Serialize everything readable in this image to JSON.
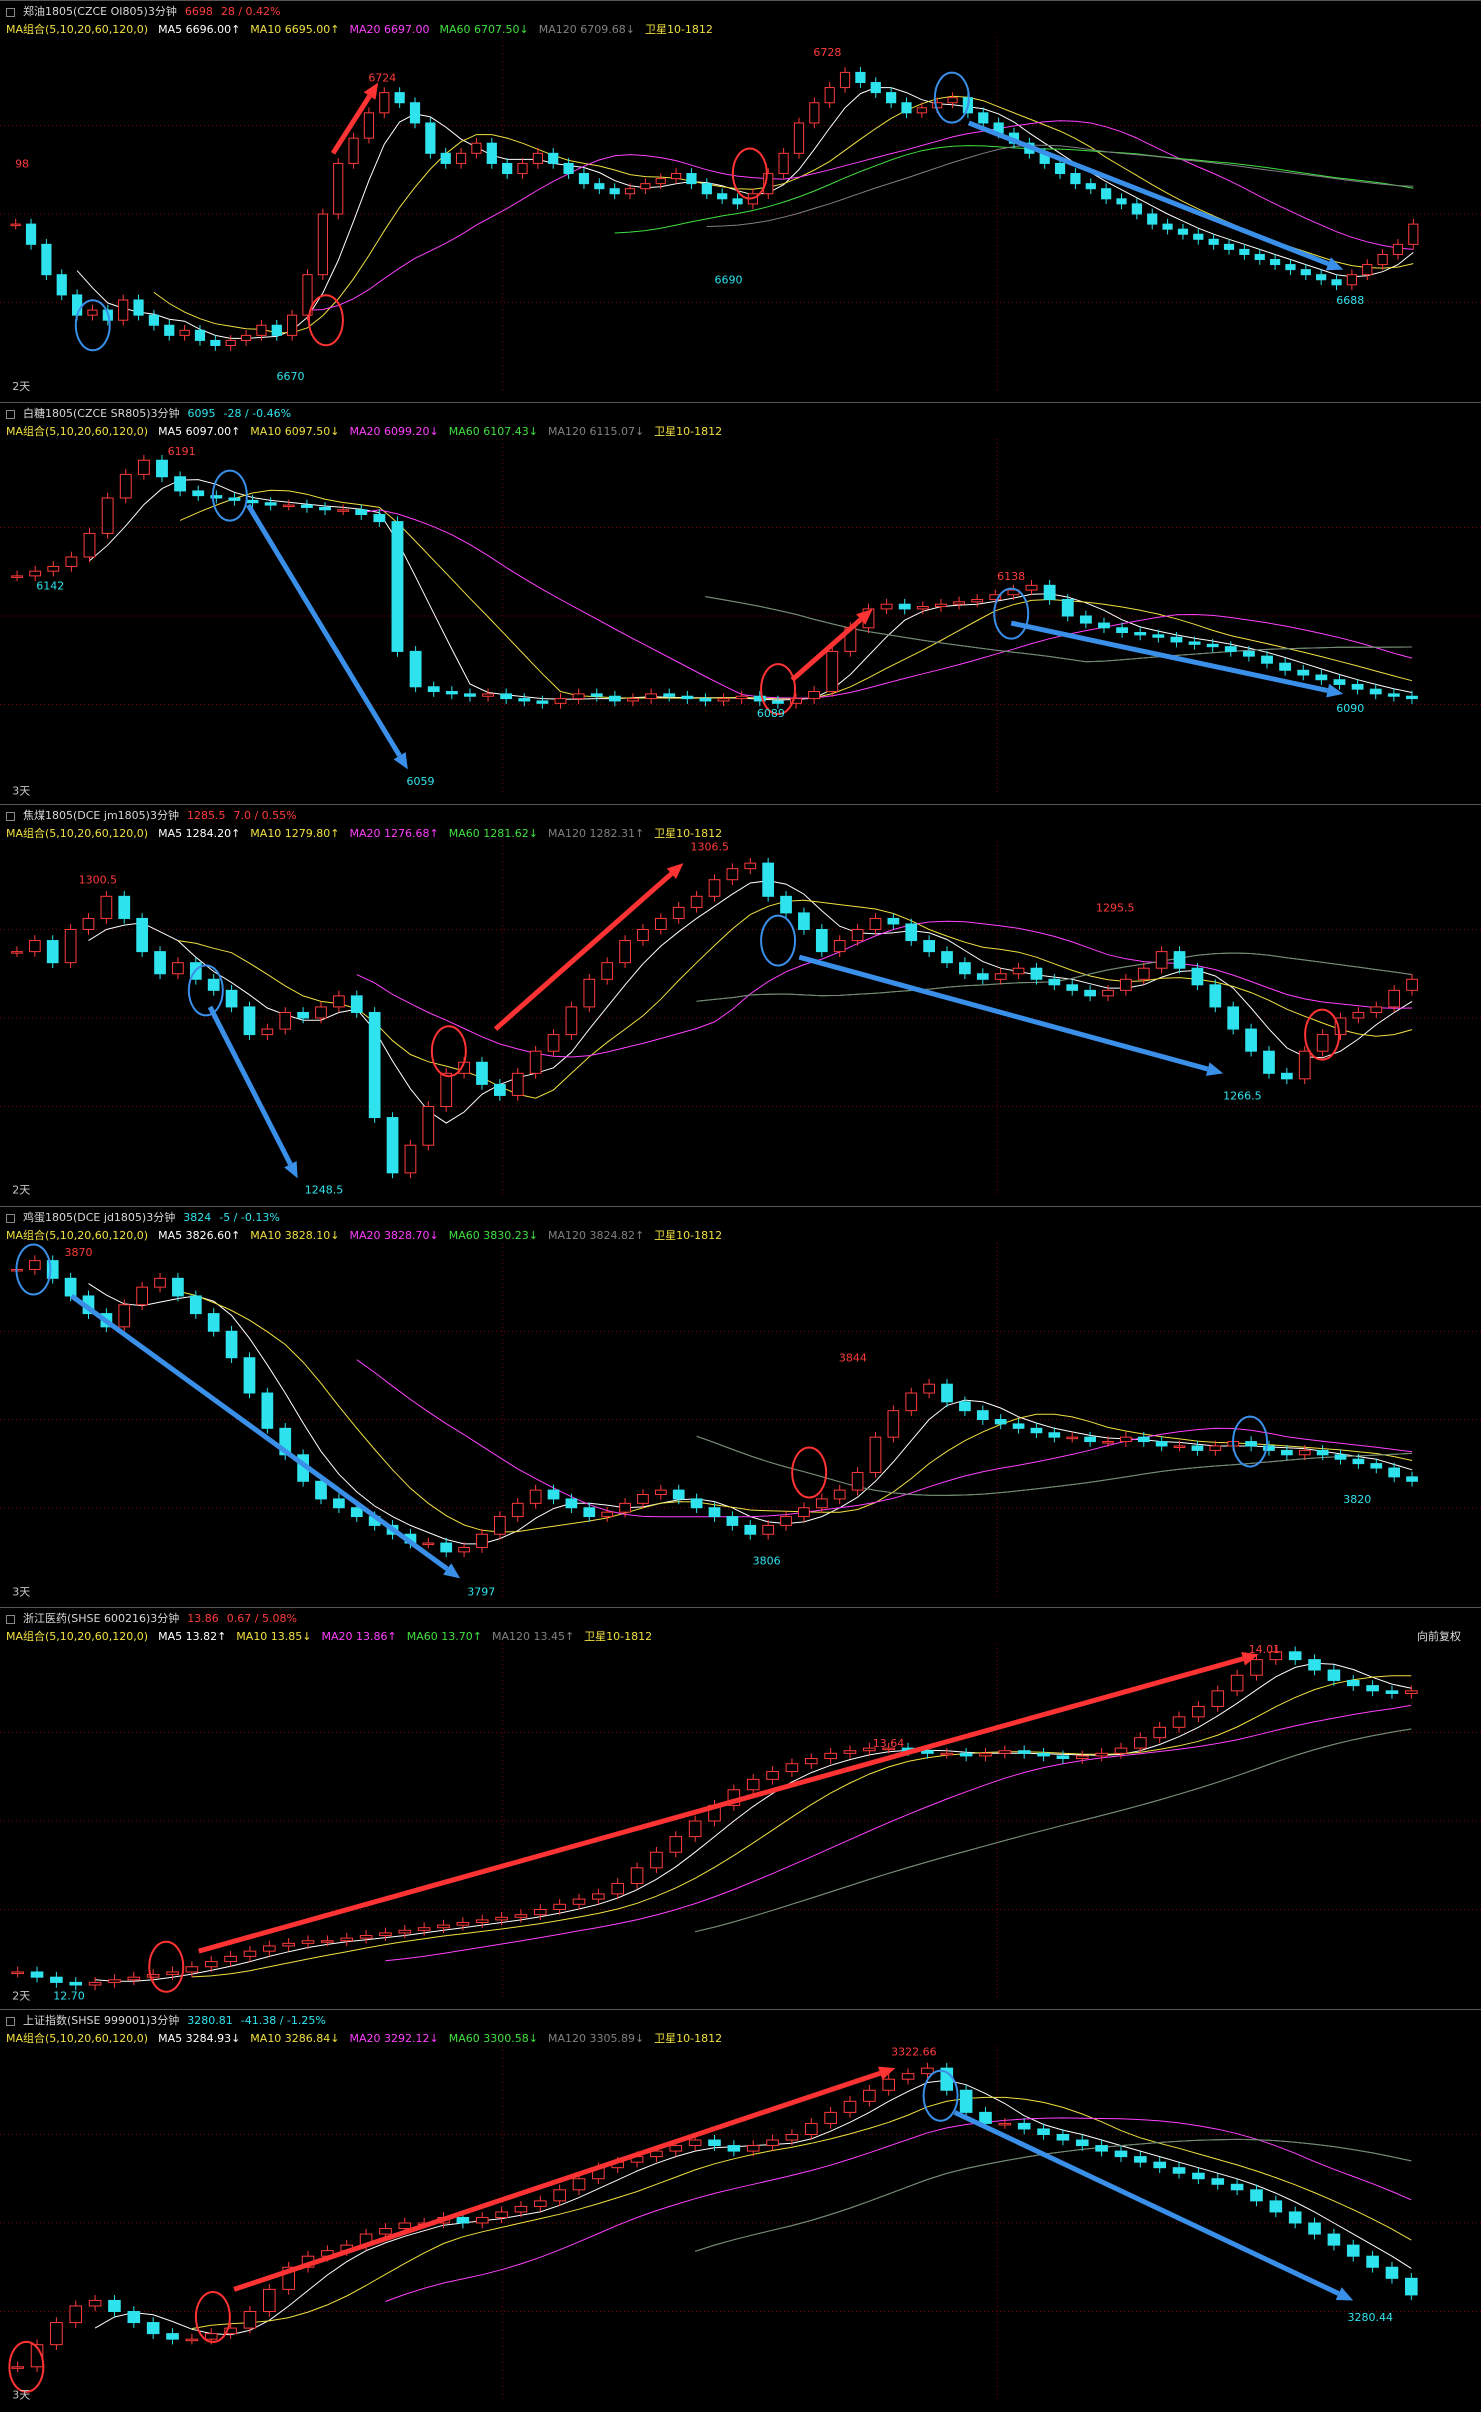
{
  "ma_settings": "MA组合(5,10,20,60,120,0)",
  "colors": {
    "up": "#ff3b3b",
    "down": "#2fe3ee",
    "ma5": "#ffffff",
    "ma10": "#f0e040",
    "ma20": "#ff40ff",
    "ma60": "#40e040",
    "ma120": "#808080",
    "grid": "#7a0000",
    "arrow_red": "#ff3333",
    "arrow_blue": "#3a8fe8",
    "circle_red": "#ff3333",
    "circle_blue": "#3a8fe8"
  },
  "panels": [
    {
      "name": "zhengyou",
      "title": "郑油1805(CZCE OI805)3分钟",
      "price": "6698",
      "change": "28 / 0.42%",
      "ma": {
        "ma5": "MA5 6696.00↑",
        "ma10": "MA10 6695.00↑",
        "ma20": "MA20 6697.00",
        "ma60": "MA60 6707.50↓",
        "ma120": "MA120 6709.68↓",
        "period": "卫星10-1812"
      },
      "range": [
        6665,
        6735
      ],
      "closes": [
        6698,
        6694,
        6688,
        6684,
        6680,
        6681,
        6679,
        6683,
        6680,
        6678,
        6676,
        6677,
        6675,
        6674,
        6675,
        6676,
        6678,
        6676,
        6680,
        6688,
        6700,
        6710,
        6715,
        6720,
        6724,
        6722,
        6718,
        6712,
        6710,
        6712,
        6714,
        6710,
        6708,
        6710,
        6712,
        6710,
        6708,
        6706,
        6705,
        6704,
        6705,
        6706,
        6707,
        6708,
        6706,
        6704,
        6703,
        6702,
        6704,
        6708,
        6712,
        6718,
        6722,
        6725,
        6728,
        6726,
        6724,
        6722,
        6720,
        6721,
        6722,
        6723,
        6720,
        6718,
        6716,
        6714,
        6712,
        6710,
        6708,
        6706,
        6705,
        6703,
        6702,
        6700,
        6698,
        6697,
        6696,
        6695,
        6694,
        6693,
        6692,
        6691,
        6690,
        6689,
        6688,
        6687,
        6686,
        6688,
        6690,
        6692,
        6694,
        6698
      ],
      "labels": [
        {
          "t": "98",
          "x": 0.005,
          "v": 6710,
          "c": "up"
        },
        {
          "t": "6724",
          "x": 0.255,
          "v": 6727,
          "c": "up"
        },
        {
          "t": "6728",
          "x": 0.57,
          "v": 6732,
          "c": "up"
        },
        {
          "t": "6690",
          "x": 0.5,
          "v": 6687,
          "c": "down"
        },
        {
          "t": "6670",
          "x": 0.19,
          "v": 6668,
          "c": "down"
        },
        {
          "t": "6688",
          "x": 0.94,
          "v": 6683,
          "c": "down"
        },
        {
          "t": "2天",
          "x": 0.003,
          "v": 6666,
          "c": "neutral"
        }
      ],
      "arrows": [
        {
          "x1": 0.23,
          "v1": 6712,
          "x2": 0.262,
          "v2": 6726,
          "c": "red"
        },
        {
          "x1": 0.68,
          "v1": 6718,
          "x2": 0.945,
          "v2": 6689,
          "c": "blue"
        }
      ],
      "circles": [
        {
          "x": 0.06,
          "v": 6678,
          "c": "blue"
        },
        {
          "x": 0.225,
          "v": 6679,
          "c": "red"
        },
        {
          "x": 0.525,
          "v": 6708,
          "c": "red"
        },
        {
          "x": 0.668,
          "v": 6723,
          "c": "blue"
        }
      ]
    },
    {
      "name": "baitang",
      "title": "白糖1805(CZCE SR805)3分钟",
      "price": "6095",
      "change": "-28 / -0.46%",
      "ma": {
        "ma5": "MA5 6097.00↑",
        "ma10": "MA10 6097.50↓",
        "ma20": "MA20 6099.20↓",
        "ma60": "MA60 6107.43↓",
        "ma120": "MA120 6115.07↓",
        "period": "卫星10-1812"
      },
      "range": [
        6050,
        6200
      ],
      "closes": [
        6142,
        6144,
        6146,
        6150,
        6160,
        6175,
        6185,
        6191,
        6184,
        6178,
        6176,
        6175,
        6174,
        6173,
        6172,
        6172,
        6171,
        6170,
        6170,
        6168,
        6165,
        6110,
        6095,
        6093,
        6092,
        6091,
        6092,
        6090,
        6089,
        6088,
        6090,
        6092,
        6091,
        6089,
        6090,
        6092,
        6091,
        6090,
        6089,
        6090,
        6091,
        6089,
        6088,
        6090,
        6093,
        6110,
        6120,
        6128,
        6130,
        6128,
        6129,
        6130,
        6131,
        6132,
        6134,
        6136,
        6138,
        6132,
        6125,
        6122,
        6120,
        6118,
        6117,
        6116,
        6114,
        6113,
        6112,
        6110,
        6108,
        6105,
        6102,
        6100,
        6098,
        6096,
        6094,
        6092,
        6091,
        6090
      ],
      "labels": [
        {
          "t": "6191",
          "x": 0.113,
          "v": 6195,
          "c": "up"
        },
        {
          "t": "6142",
          "x": 0.02,
          "v": 6138,
          "c": "down"
        },
        {
          "t": "6059",
          "x": 0.282,
          "v": 6055,
          "c": "down"
        },
        {
          "t": "6089",
          "x": 0.53,
          "v": 6084,
          "c": "down"
        },
        {
          "t": "6138",
          "x": 0.7,
          "v": 6142,
          "c": "up"
        },
        {
          "t": "6090",
          "x": 0.94,
          "v": 6086,
          "c": "down"
        },
        {
          "t": "3天",
          "x": 0.003,
          "v": 6051,
          "c": "neutral"
        }
      ],
      "arrows": [
        {
          "x1": 0.17,
          "v1": 6172,
          "x2": 0.283,
          "v2": 6060,
          "c": "blue"
        },
        {
          "x1": 0.555,
          "v1": 6098,
          "x2": 0.612,
          "v2": 6128,
          "c": "red"
        },
        {
          "x1": 0.71,
          "v1": 6122,
          "x2": 0.945,
          "v2": 6092,
          "c": "blue"
        }
      ],
      "circles": [
        {
          "x": 0.157,
          "v": 6176,
          "c": "blue"
        },
        {
          "x": 0.545,
          "v": 6094,
          "c": "red"
        },
        {
          "x": 0.71,
          "v": 6126,
          "c": "blue"
        }
      ]
    },
    {
      "name": "jiaomei",
      "title": "焦煤1805(DCE jm1805)3分钟",
      "price": "1285.5",
      "change": "7.0 / 0.55%",
      "ma": {
        "ma5": "MA5 1284.20↑",
        "ma10": "MA10 1279.80↑",
        "ma20": "MA20 1276.68↑",
        "ma60": "MA60 1281.62↓",
        "ma120": "MA120 1282.31↑",
        "period": "卫星10-1812"
      },
      "range": [
        1246,
        1310
      ],
      "closes": [
        1290,
        1292,
        1288,
        1294,
        1296,
        1300,
        1296,
        1290,
        1286,
        1288,
        1285,
        1283,
        1280,
        1275,
        1276,
        1279,
        1278,
        1280,
        1282,
        1279,
        1260,
        1250,
        1255,
        1262,
        1268,
        1270,
        1266,
        1264,
        1268,
        1272,
        1275,
        1280,
        1285,
        1288,
        1292,
        1294,
        1296,
        1298,
        1300,
        1303,
        1305,
        1306,
        1300,
        1297,
        1294,
        1290,
        1292,
        1294,
        1296,
        1295,
        1292,
        1290,
        1288,
        1286,
        1285,
        1286,
        1287,
        1285,
        1284,
        1283,
        1282,
        1283,
        1285,
        1287,
        1290,
        1287,
        1284,
        1280,
        1276,
        1272,
        1268,
        1267,
        1272,
        1275,
        1278,
        1279,
        1280,
        1283,
        1285
      ],
      "labels": [
        {
          "t": "1300.5",
          "x": 0.05,
          "v": 1303,
          "c": "up"
        },
        {
          "t": "1306.5",
          "x": 0.483,
          "v": 1309,
          "c": "up"
        },
        {
          "t": "1295.5",
          "x": 0.77,
          "v": 1298,
          "c": "up"
        },
        {
          "t": "1248.5",
          "x": 0.21,
          "v": 1247,
          "c": "down"
        },
        {
          "t": "1266.5",
          "x": 0.86,
          "v": 1264,
          "c": "down"
        },
        {
          "t": "2天",
          "x": 0.003,
          "v": 1247,
          "c": "neutral"
        }
      ],
      "arrows": [
        {
          "x1": 0.143,
          "v1": 1280,
          "x2": 0.205,
          "v2": 1249,
          "c": "blue"
        },
        {
          "x1": 0.345,
          "v1": 1276,
          "x2": 0.478,
          "v2": 1306,
          "c": "red"
        },
        {
          "x1": 0.56,
          "v1": 1289,
          "x2": 0.86,
          "v2": 1268,
          "c": "blue"
        }
      ],
      "circles": [
        {
          "x": 0.14,
          "v": 1283,
          "c": "blue"
        },
        {
          "x": 0.312,
          "v": 1272,
          "c": "red"
        },
        {
          "x": 0.545,
          "v": 1292,
          "c": "blue"
        },
        {
          "x": 0.93,
          "v": 1275,
          "c": "red"
        }
      ]
    },
    {
      "name": "jidan",
      "title": "鸡蛋1805(DCE jd1805)3分钟",
      "price": "3824",
      "change": "-5 / -0.13%",
      "ma": {
        "ma5": "MA5 3826.60↑",
        "ma10": "MA10 3828.10↓",
        "ma20": "MA20 3828.70↓",
        "ma60": "MA60 3830.23↓",
        "ma120": "MA120 3824.82↑",
        "period": "卫星10-1812"
      },
      "range": [
        3794,
        3874
      ],
      "closes": [
        3868,
        3870,
        3866,
        3862,
        3858,
        3855,
        3860,
        3864,
        3866,
        3862,
        3858,
        3854,
        3848,
        3840,
        3832,
        3826,
        3820,
        3816,
        3814,
        3812,
        3810,
        3808,
        3806,
        3806,
        3804,
        3805,
        3808,
        3812,
        3815,
        3818,
        3816,
        3814,
        3812,
        3813,
        3815,
        3817,
        3818,
        3816,
        3814,
        3812,
        3810,
        3808,
        3810,
        3812,
        3814,
        3816,
        3818,
        3822,
        3830,
        3836,
        3840,
        3842,
        3838,
        3836,
        3834,
        3833,
        3832,
        3831,
        3830,
        3830,
        3829,
        3829,
        3830,
        3829,
        3828,
        3828,
        3827,
        3828,
        3829,
        3828,
        3827,
        3826,
        3827,
        3826,
        3825,
        3824,
        3823,
        3821,
        3820
      ],
      "labels": [
        {
          "t": "3870",
          "x": 0.04,
          "v": 3872,
          "c": "up"
        },
        {
          "t": "3844",
          "x": 0.588,
          "v": 3848,
          "c": "up"
        },
        {
          "t": "3797",
          "x": 0.325,
          "v": 3795,
          "c": "down"
        },
        {
          "t": "3806",
          "x": 0.527,
          "v": 3802,
          "c": "down"
        },
        {
          "t": "3820",
          "x": 0.945,
          "v": 3816,
          "c": "down"
        },
        {
          "t": "3天",
          "x": 0.003,
          "v": 3795,
          "c": "neutral"
        }
      ],
      "arrows": [
        {
          "x1": 0.045,
          "v1": 3862,
          "x2": 0.32,
          "v2": 3798,
          "c": "blue"
        }
      ],
      "circles": [
        {
          "x": 0.018,
          "v": 3868,
          "c": "blue"
        },
        {
          "x": 0.567,
          "v": 3822,
          "c": "red"
        },
        {
          "x": 0.879,
          "v": 3829,
          "c": "blue"
        }
      ]
    },
    {
      "name": "zhejiangyiyao",
      "title": "浙江医药(SHSE 600216)3分钟",
      "price": "13.86",
      "change": "0.67 / 5.08%",
      "ma": {
        "ma5": "MA5 13.82↑",
        "ma10": "MA10 13.85↓",
        "ma20": "MA20 13.86↑",
        "ma60": "MA60 13.70↑",
        "ma120": "MA120 13.45↑",
        "period": "卫星10-1812"
      },
      "fq": "向前复权",
      "range": [
        12.68,
        14.04
      ],
      "closes": [
        12.78,
        12.76,
        12.74,
        12.73,
        12.74,
        12.75,
        12.76,
        12.77,
        12.78,
        12.8,
        12.82,
        12.84,
        12.86,
        12.88,
        12.89,
        12.9,
        12.9,
        12.91,
        12.92,
        12.93,
        12.94,
        12.95,
        12.96,
        12.97,
        12.98,
        12.99,
        13.0,
        13.02,
        13.04,
        13.06,
        13.08,
        13.12,
        13.18,
        13.24,
        13.3,
        13.36,
        13.42,
        13.48,
        13.52,
        13.55,
        13.58,
        13.6,
        13.62,
        13.63,
        13.64,
        13.64,
        13.63,
        13.62,
        13.62,
        13.61,
        13.62,
        13.63,
        13.62,
        13.61,
        13.6,
        13.61,
        13.62,
        13.64,
        13.68,
        13.72,
        13.76,
        13.8,
        13.86,
        13.92,
        13.98,
        14.01,
        13.98,
        13.94,
        13.9,
        13.88,
        13.86,
        13.85,
        13.86
      ],
      "labels": [
        {
          "t": "14.01",
          "x": 0.878,
          "v": 14.02,
          "c": "up"
        },
        {
          "t": "13.64",
          "x": 0.612,
          "v": 13.66,
          "c": "up"
        },
        {
          "t": "12.70",
          "x": 0.032,
          "v": 12.69,
          "c": "down"
        },
        {
          "t": "2天",
          "x": 0.003,
          "v": 12.69,
          "c": "neutral"
        }
      ],
      "arrows": [
        {
          "x1": 0.135,
          "v1": 12.86,
          "x2": 0.885,
          "v2": 14.0,
          "c": "red"
        }
      ],
      "circles": [
        {
          "x": 0.112,
          "v": 12.8,
          "c": "red"
        }
      ]
    },
    {
      "name": "shangzheng",
      "title": "上证指数(SHSE 999001)3分钟",
      "price": "3280.81",
      "change": "-41.38 / -1.25%",
      "ma": {
        "ma5": "MA5 3284.93↓",
        "ma10": "MA10 3286.84↓",
        "ma20": "MA20 3292.12↓",
        "ma60": "MA60 3300.58↓",
        "ma120": "MA120 3305.89↓",
        "period": "卫星10-1812"
      },
      "range": [
        3262,
        3326
      ],
      "closes": [
        3268,
        3272,
        3276,
        3279,
        3280,
        3278,
        3276,
        3274,
        3273,
        3273,
        3274,
        3275,
        3278,
        3282,
        3286,
        3288,
        3289,
        3290,
        3292,
        3293,
        3294,
        3294,
        3295,
        3294,
        3295,
        3296,
        3297,
        3298,
        3300,
        3302,
        3304,
        3305,
        3306,
        3307,
        3308,
        3309,
        3308,
        3307,
        3308,
        3309,
        3310,
        3312,
        3314,
        3316,
        3318,
        3320,
        3321,
        3322,
        3318,
        3314,
        3312,
        3312,
        3311,
        3310,
        3309,
        3308,
        3307,
        3306,
        3305,
        3304,
        3303,
        3302,
        3301,
        3300,
        3298,
        3296,
        3294,
        3292,
        3290,
        3288,
        3286,
        3284,
        3281
      ],
      "labels": [
        {
          "t": "3322.66",
          "x": 0.625,
          "v": 3325,
          "c": "up"
        },
        {
          "t": "3280.44",
          "x": 0.948,
          "v": 3277,
          "c": "down"
        },
        {
          "t": "3天",
          "x": 0.003,
          "v": 3263,
          "c": "neutral"
        }
      ],
      "arrows": [
        {
          "x1": 0.16,
          "v1": 3282,
          "x2": 0.628,
          "v2": 3322,
          "c": "red"
        },
        {
          "x1": 0.67,
          "v1": 3314,
          "x2": 0.952,
          "v2": 3280,
          "c": "blue"
        }
      ],
      "circles": [
        {
          "x": 0.013,
          "v": 3268,
          "c": "red"
        },
        {
          "x": 0.145,
          "v": 3277,
          "c": "red"
        },
        {
          "x": 0.66,
          "v": 3317,
          "c": "blue"
        }
      ]
    }
  ]
}
